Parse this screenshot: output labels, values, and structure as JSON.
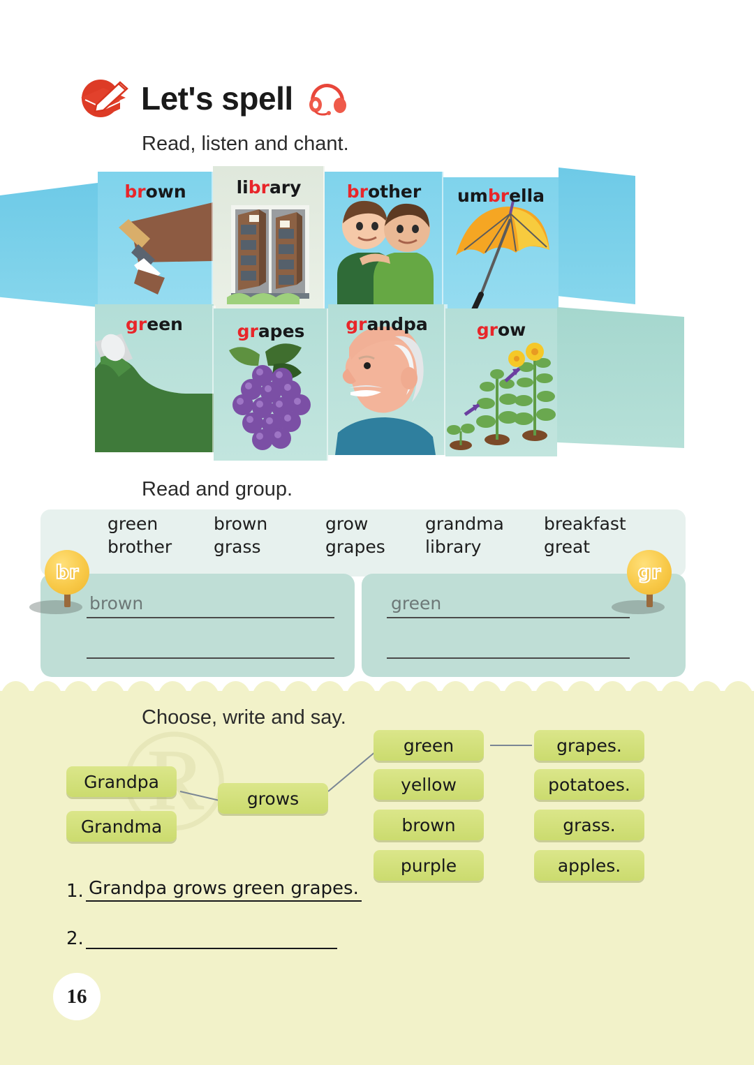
{
  "header": {
    "title": "Let's spell",
    "cap_icon": "graduation-cap-pencil-icon",
    "audio_icon": "headphones-icon",
    "subtitle": "Read, listen and chant."
  },
  "chant_panels": {
    "row1": [
      {
        "word": "brown",
        "prefix": "br",
        "rest": "own",
        "image": "paintbrush-brown-paint"
      },
      {
        "word": "library",
        "prefix": "br",
        "rest": "ary",
        "pre": "li",
        "image": "library-bookshelves"
      },
      {
        "word": "brother",
        "prefix": "br",
        "rest": "other",
        "image": "two-brothers"
      },
      {
        "word": "umbrella",
        "prefix": "br",
        "rest": "ella",
        "pre": "um",
        "image": "yellow-umbrella"
      }
    ],
    "row2": [
      {
        "word": "green",
        "prefix": "gr",
        "rest": "een",
        "image": "green-paint-can"
      },
      {
        "word": "grapes",
        "prefix": "gr",
        "rest": "apes",
        "image": "purple-grapes"
      },
      {
        "word": "grandpa",
        "prefix": "gr",
        "rest": "andpa",
        "image": "grandpa-portrait"
      },
      {
        "word": "grow",
        "prefix": "gr",
        "rest": "ow",
        "image": "growing-plants"
      }
    ]
  },
  "read_and_group": {
    "title": "Read and group.",
    "word_bank": {
      "row1": [
        "green",
        "brown",
        "grow",
        "grandma",
        "breakfast"
      ],
      "row2": [
        "brother",
        "grass",
        "grapes",
        "library",
        "great"
      ]
    },
    "groups": [
      {
        "badge": "br",
        "answers": [
          "brown",
          ""
        ]
      },
      {
        "badge": "gr",
        "answers": [
          "green",
          ""
        ]
      }
    ]
  },
  "choose_write_say": {
    "title": "Choose, write and say.",
    "columns": {
      "subjects": [
        "Grandpa",
        "Grandma"
      ],
      "verbs": [
        "grows"
      ],
      "adjectives": [
        "green",
        "yellow",
        "brown",
        "purple"
      ],
      "objects": [
        "grapes.",
        "potatoes.",
        "grass.",
        "apples."
      ]
    },
    "answers": [
      {
        "number": "1.",
        "text": "Grandpa grows green grapes."
      },
      {
        "number": "2.",
        "text": ""
      }
    ]
  },
  "page_number": "16",
  "colors": {
    "accent_red": "#e8262a",
    "panel_blue": "#7fd3ec",
    "panel_teal": "#b3ded7",
    "badge_yellow": "#f8c948",
    "card_green": "#cbdb6e",
    "section_yellow": "#f2f2c9",
    "answer_box_teal": "#bfded6"
  }
}
